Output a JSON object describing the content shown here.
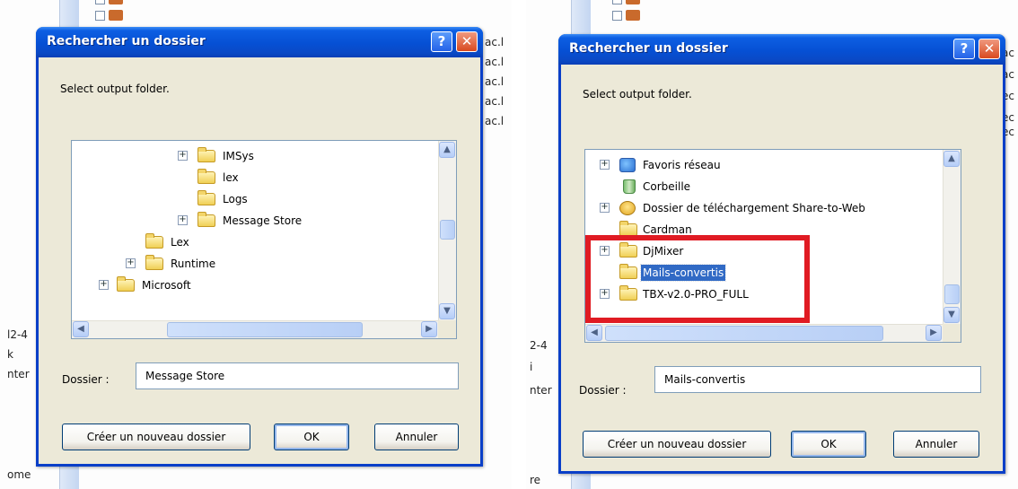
{
  "left": {
    "dialog": {
      "title": "Rechercher un dossier",
      "prompt": "Select output folder.",
      "tree": [
        {
          "label": "IMSys",
          "expander": "+"
        },
        {
          "label": "lex",
          "expander": ""
        },
        {
          "label": "Logs",
          "expander": ""
        },
        {
          "label": "Message Store",
          "expander": "+"
        },
        {
          "label": "Lex",
          "expander": ""
        },
        {
          "label": "Runtime",
          "expander": "+"
        },
        {
          "label": "Microsoft",
          "expander": "+"
        }
      ],
      "folder_label": "Dossier :",
      "folder_value": "Message Store",
      "buttons": {
        "new_folder": "Créer un nouveau dossier",
        "ok": "OK",
        "cancel": "Annuler"
      }
    },
    "fragments": [
      "l2-4",
      "k",
      "nter",
      "ome"
    ],
    "bg_right_fragments": [
      "ac.l",
      "ac.l",
      "ac.l",
      "ac.l",
      "ac.l"
    ]
  },
  "right": {
    "dialog": {
      "title": "Rechercher un dossier",
      "prompt": "Select output folder.",
      "tree": [
        {
          "label": "Favoris réseau",
          "expander": "+",
          "icon": "network"
        },
        {
          "label": "Corbeille",
          "expander": "",
          "icon": "recycle-bin"
        },
        {
          "label": "Dossier de téléchargement Share-to-Web",
          "expander": "+",
          "icon": "share"
        },
        {
          "label": "Cardman",
          "expander": "",
          "icon": "folder"
        },
        {
          "label": "DjMixer",
          "expander": "+",
          "icon": "folder"
        },
        {
          "label": "Mails-convertis",
          "expander": "",
          "icon": "folder",
          "selected": true
        },
        {
          "label": "TBX-v2.0-PRO_FULL",
          "expander": "+",
          "icon": "folder"
        }
      ],
      "folder_label": "Dossier :",
      "folder_value": "Mails-convertis",
      "buttons": {
        "new_folder": "Créer un nouveau dossier",
        "ok": "OK",
        "cancel": "Annuler"
      }
    },
    "fragments": [
      "2-4",
      "i",
      "nter",
      "re"
    ],
    "bg_right_fragments": [
      "ac",
      "ac",
      "ec",
      "ec",
      "ec"
    ]
  },
  "colors": {
    "titlebar": "#0650d4",
    "selection": "#316ac5",
    "highlight_box": "#e01b23"
  }
}
